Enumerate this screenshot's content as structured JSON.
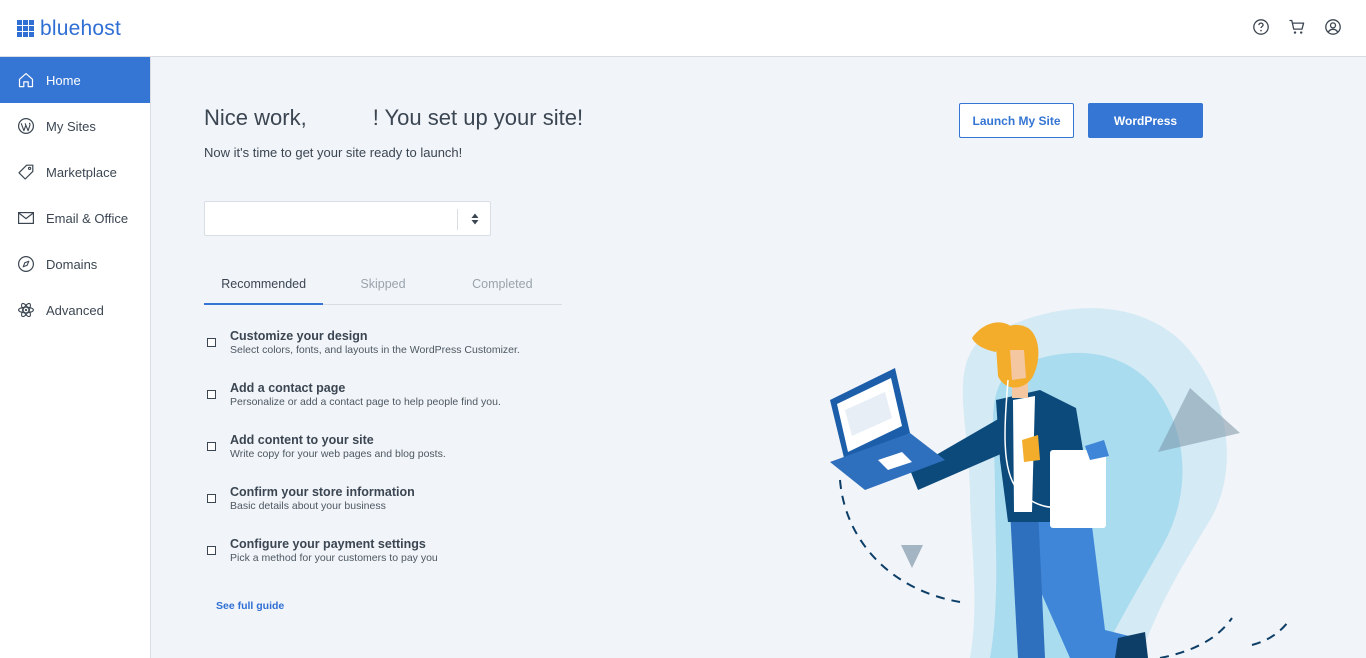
{
  "header": {
    "logo_text": "bluehost",
    "icons": [
      "help-icon",
      "cart-icon",
      "account-icon"
    ],
    "brand_color": "#2f6fd4"
  },
  "sidebar": {
    "items": [
      {
        "label": "Home",
        "icon": "home-icon",
        "active": true
      },
      {
        "label": "My Sites",
        "icon": "wordpress-icon",
        "active": false
      },
      {
        "label": "Marketplace",
        "icon": "tag-icon",
        "active": false
      },
      {
        "label": "Email & Office",
        "icon": "mail-icon",
        "active": false
      },
      {
        "label": "Domains",
        "icon": "compass-icon",
        "active": false
      },
      {
        "label": "Advanced",
        "icon": "atom-icon",
        "active": false
      }
    ],
    "active_color": "#3575d3"
  },
  "main": {
    "title_prefix": "Nice work,",
    "title_suffix": "! You set up your site!",
    "subtitle": "Now it's time to get your site ready to launch!",
    "site_select_value": "",
    "buttons": {
      "launch": "Launch My Site",
      "wordpress": "WordPress"
    },
    "tabs": [
      {
        "label": "Recommended",
        "active": true
      },
      {
        "label": "Skipped",
        "active": false
      },
      {
        "label": "Completed",
        "active": false
      }
    ],
    "tasks": [
      {
        "title": "Customize your design",
        "desc": "Select colors, fonts, and layouts in the WordPress Customizer.",
        "checked": false
      },
      {
        "title": "Add a contact page",
        "desc": "Personalize or add a contact page to help people find you.",
        "checked": false
      },
      {
        "title": "Add content to your site",
        "desc": "Write copy for your web pages and blog posts.",
        "checked": false
      },
      {
        "title": "Confirm your store information",
        "desc": "Basic details about your business",
        "checked": false
      },
      {
        "title": "Configure your payment settings",
        "desc": "Pick a method for your customers to pay you",
        "checked": false
      }
    ],
    "guide_link": "See full guide"
  }
}
